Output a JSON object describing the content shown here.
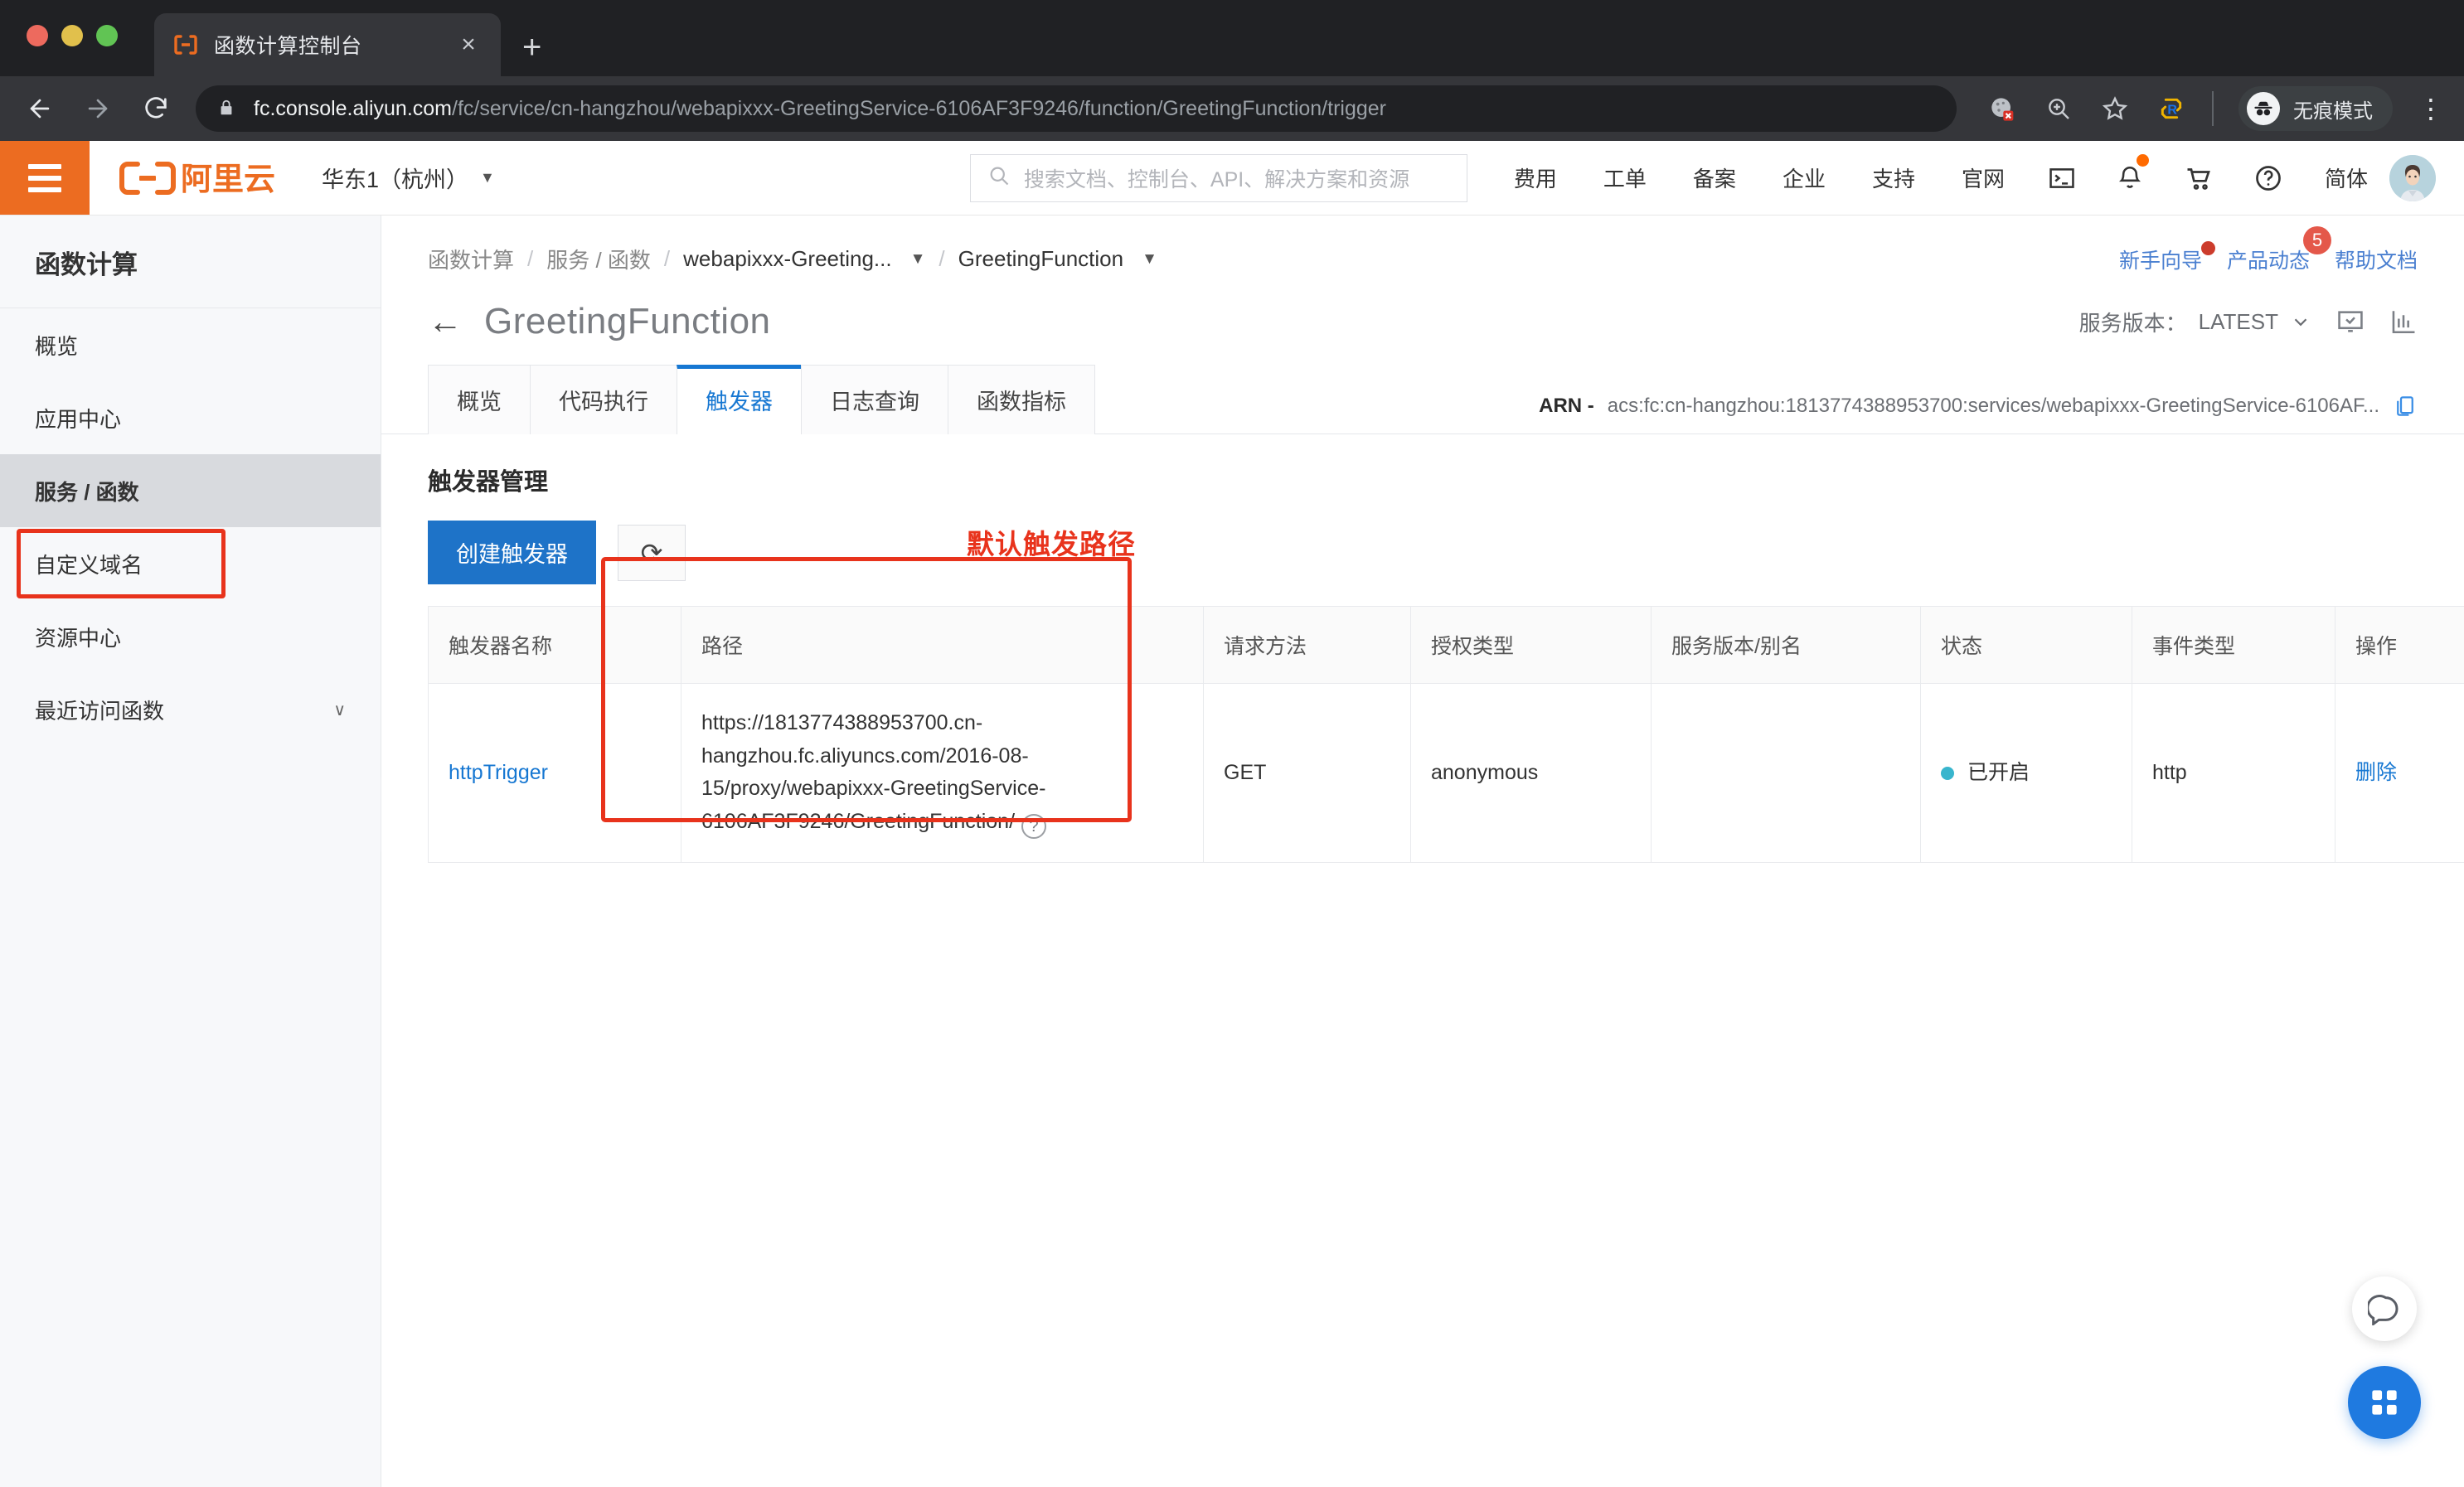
{
  "browser": {
    "tab": {
      "title": "函数计算控制台",
      "favicon": "aliyun-fc-favicon",
      "close": "×"
    },
    "new_tab": "+",
    "url": {
      "host": "fc.console.aliyun.com",
      "path": "/fc/service/cn-hangzhou/webapixxx-GreetingService-6106AF3F9246/function/GreetingFunction/trigger"
    },
    "incognito_label": "无痕模式",
    "icons": [
      "back-icon",
      "forward-icon",
      "reload-icon",
      "lock-icon",
      "cookie-blocked-icon",
      "zoom-search-icon",
      "star-icon",
      "extension-r-icon",
      "incognito-icon",
      "kebab-menu-icon"
    ]
  },
  "topnav": {
    "logo_text": "阿里云",
    "region": "华东1（杭州）",
    "search_placeholder": "搜索文档、控制台、API、解决方案和资源",
    "links": [
      "费用",
      "工单",
      "备案",
      "企业",
      "支持",
      "官网"
    ],
    "lang": "简体",
    "icons": [
      "terminal-icon",
      "bell-icon",
      "cart-icon",
      "help-icon",
      "avatar"
    ]
  },
  "sidebar": {
    "title": "函数计算",
    "items": [
      {
        "label": "概览",
        "active": false
      },
      {
        "label": "应用中心",
        "active": false
      },
      {
        "label": "服务 / 函数",
        "active": true
      },
      {
        "label": "自定义域名",
        "active": false,
        "highlighted": true
      },
      {
        "label": "资源中心",
        "active": false
      },
      {
        "label": "最近访问函数",
        "active": false,
        "chevron": "∨"
      }
    ]
  },
  "breadcrumb": {
    "items": [
      "函数计算",
      "服务 / 函数",
      "webapixxx-Greeting...",
      "GreetingFunction"
    ],
    "separator": "/"
  },
  "header_links": [
    {
      "label": "新手向导",
      "dot": true
    },
    {
      "label": "产品动态",
      "badge": "5"
    },
    {
      "label": "帮助文档"
    }
  ],
  "page": {
    "title": "GreetingFunction",
    "back": "←",
    "version_label": "服务版本：",
    "version_value": "LATEST"
  },
  "tabs": [
    {
      "label": "概览",
      "active": false
    },
    {
      "label": "代码执行",
      "active": false
    },
    {
      "label": "触发器",
      "active": true
    },
    {
      "label": "日志查询",
      "active": false
    },
    {
      "label": "函数指标",
      "active": false
    }
  ],
  "arn": {
    "label": "ARN -",
    "value": "acs:fc:cn-hangzhou:1813774388953700:services/webapixxx-GreetingService-6106AF..."
  },
  "section": {
    "title": "触发器管理",
    "create_button": "创建触发器",
    "refresh_button": "⟳",
    "annotation": "默认触发路径"
  },
  "table": {
    "columns": [
      "触发器名称",
      "路径",
      "请求方法",
      "授权类型",
      "服务版本/别名",
      "状态",
      "事件类型",
      "操作"
    ],
    "rows": [
      {
        "name": "httpTrigger",
        "path": "https://1813774388953700.cn-hangzhou.fc.aliyuncs.com/2016-08-15/proxy/webapixxx-GreetingService-6106AF3F9246/GreetingFunction/",
        "method": "GET",
        "auth": "anonymous",
        "version": "",
        "status": "已开启",
        "event_type": "http",
        "action": "删除"
      }
    ]
  },
  "fabs": [
    "chat-bubble-icon",
    "app-grid-icon"
  ],
  "colors": {
    "accent_orange": "#ec6c21",
    "link_blue": "#1677d2",
    "primary_button": "#1e73c8",
    "annotation_red": "#e8331c",
    "status_teal": "#38b5cd",
    "badge_red": "#e4584a"
  }
}
